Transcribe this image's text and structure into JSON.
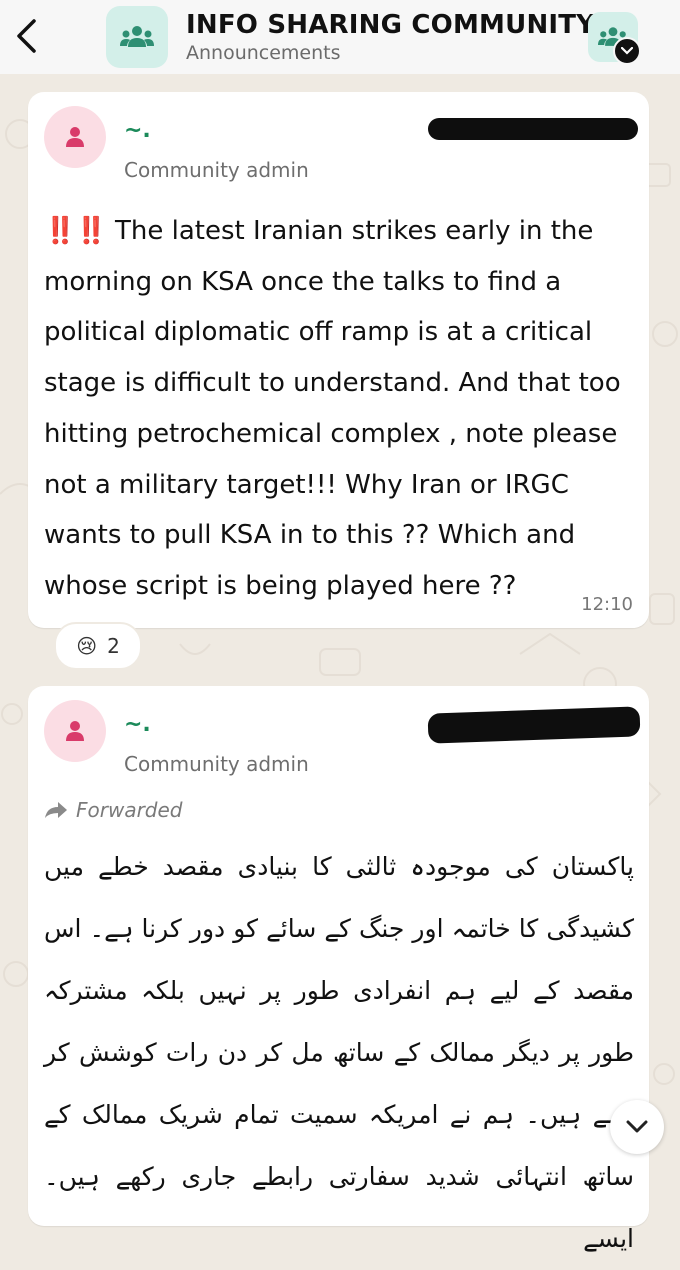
{
  "header": {
    "title": "INFO SHARING COMMUNITY",
    "subtitle": "Announcements"
  },
  "messages": [
    {
      "sender": "~.",
      "role": "Community admin",
      "emphasis": "‼️‼️",
      "text": "The latest Iranian strikes early in the morning on KSA once the talks to find a political diplomatic off ramp is at a critical stage is difficult to understand. And that too hitting petrochemical complex , note please not a military target!!! Why Iran or IRGC wants to pull KSA in to this ?? Which and whose script is being played here ??",
      "time": "12:10",
      "reaction": {
        "emoji": "😢",
        "count": "2"
      }
    },
    {
      "sender": "~.",
      "role": "Community admin",
      "forwarded_label": "Forwarded",
      "text": "پاکستان کی موجودہ ثالثی کا بنیادی مقصد خطے میں کشیدگی کا خاتمہ اور جنگ کے سائے کو دور کرنا ہے۔ اس مقصد کے لیے ہم انفرادی طور پر نہیں بلکہ مشترکہ طور پر دیگر ممالک کے ساتھ مل کر دن رات کوشش کر رہے ہیں۔ ہم نے امریکہ سمیت تمام شریک ممالک کے ساتھ انتہائی شدید سفارتی رابطے جاری رکھے ہیں۔ ایسے"
    }
  ],
  "colors": {
    "background": "#efeae2",
    "header_bg": "#f7f7f7",
    "accent_green": "#1b8a5a",
    "community_icon_bg": "#d3efe9",
    "admin_avatar_bg": "#fbdde4",
    "alert_red": "#e0282e"
  },
  "icons": {
    "back": "chevron-left-icon",
    "community": "community-group-icon",
    "admin_avatar": "person-icon",
    "forwarded": "forward-arrow-icon",
    "scroll": "chevron-down-icon"
  }
}
